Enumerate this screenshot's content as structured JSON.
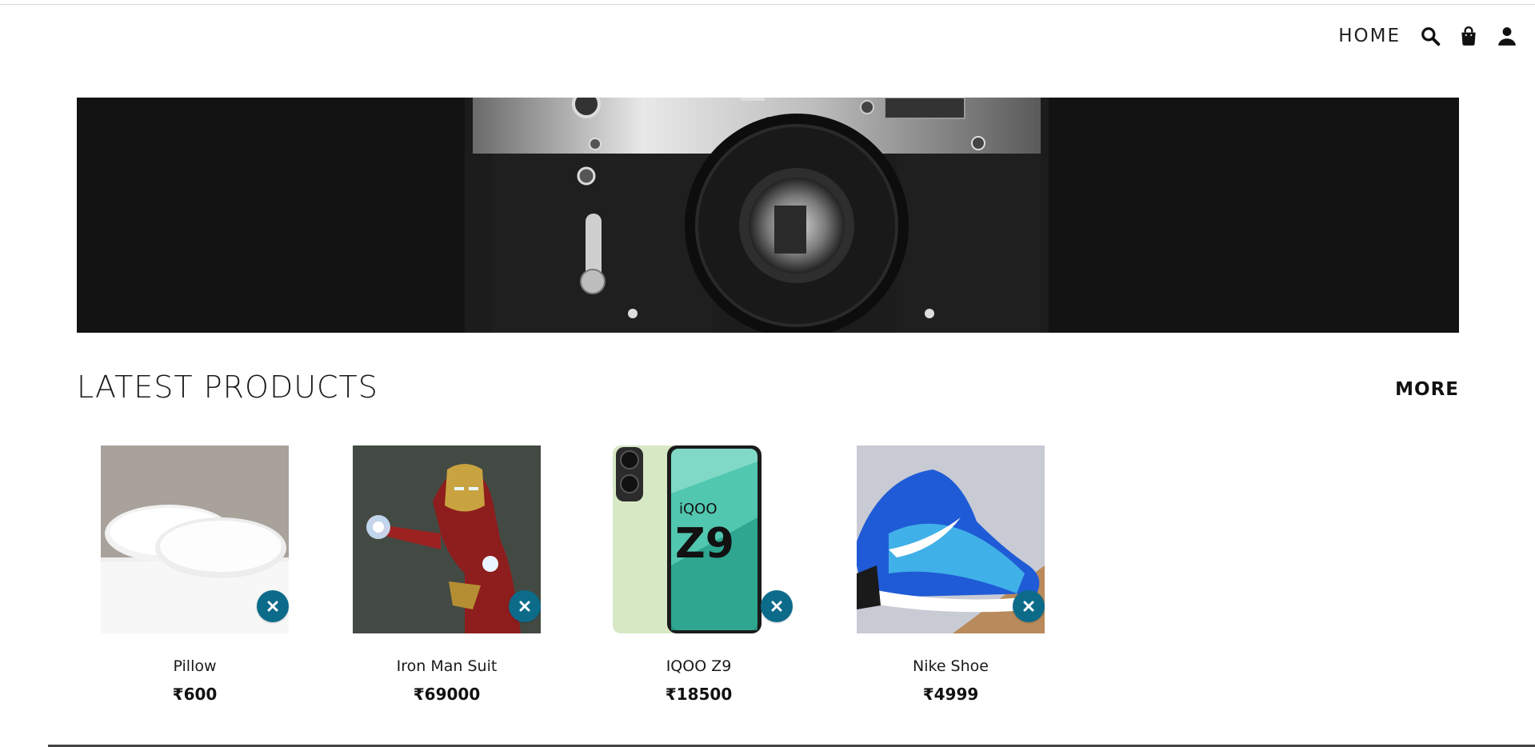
{
  "nav": {
    "home_label": "HOME",
    "icons": [
      "search-icon",
      "shopping-bag-icon",
      "user-icon"
    ]
  },
  "banner": {
    "image": "vintage camera banner"
  },
  "section": {
    "title": "LATEST PRODUCTS",
    "more_label": "MORE"
  },
  "products": [
    {
      "name": "Pillow",
      "price": "₹600"
    },
    {
      "name": "Iron Man Suit",
      "price": "₹69000"
    },
    {
      "name": "IQOO Z9",
      "price": "₹18500"
    },
    {
      "name": "Nike Shoe",
      "price": "₹4999"
    }
  ],
  "colors": {
    "remove_button": "#0d6b8a",
    "banner_bg": "#121212"
  }
}
